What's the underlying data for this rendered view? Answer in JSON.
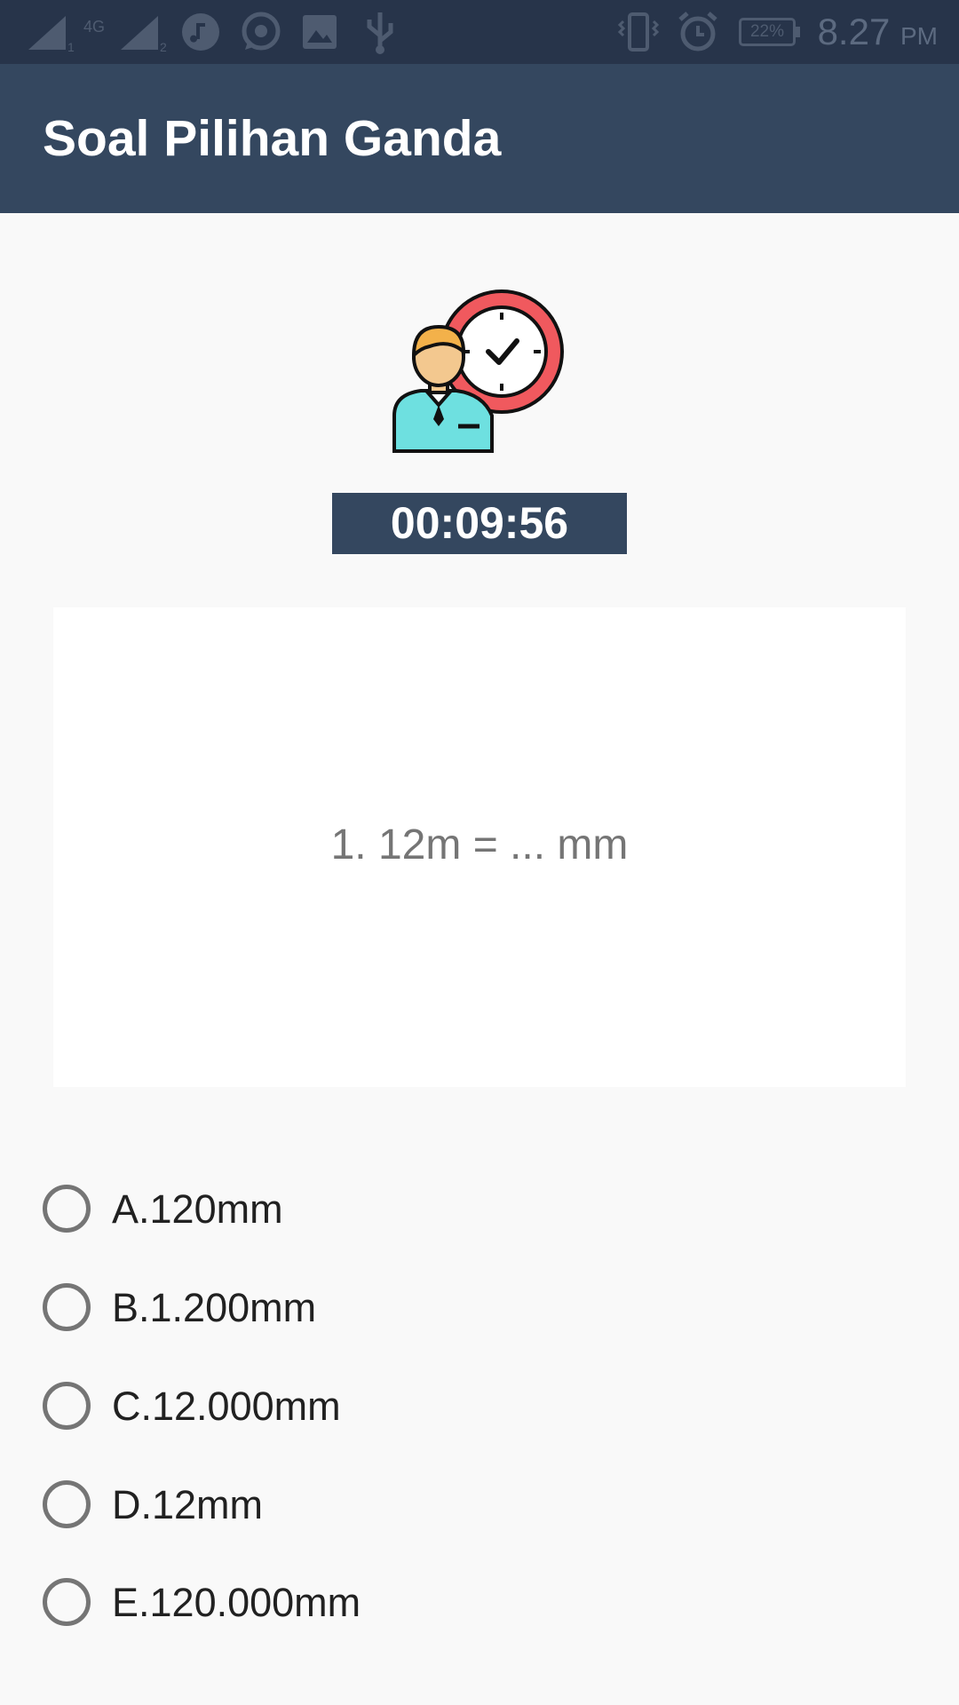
{
  "status_bar": {
    "network": "4G",
    "sim1": "1",
    "sim2": "2",
    "battery": "22%",
    "time": "8.27",
    "ampm": "PM",
    "icons": [
      "signal-icon",
      "music-icon",
      "whatsapp-icon",
      "image-icon",
      "usb-icon",
      "vibrate-icon",
      "alarm-icon",
      "battery-icon"
    ]
  },
  "app_bar": {
    "title": "Soal Pilihan Ganda"
  },
  "timer": {
    "value": "00:09:56"
  },
  "question": {
    "text": "1. 12m = ... mm"
  },
  "options": [
    {
      "label": "A.120mm"
    },
    {
      "label": "B.1.200mm"
    },
    {
      "label": "C.12.000mm"
    },
    {
      "label": "D.12mm"
    },
    {
      "label": "E.120.000mm"
    }
  ],
  "colors": {
    "primary": "#34475f",
    "status_bar": "#27344a",
    "background": "#f9f9f9",
    "clock_red": "#f0595e",
    "person_teal": "#6ee0e0"
  }
}
